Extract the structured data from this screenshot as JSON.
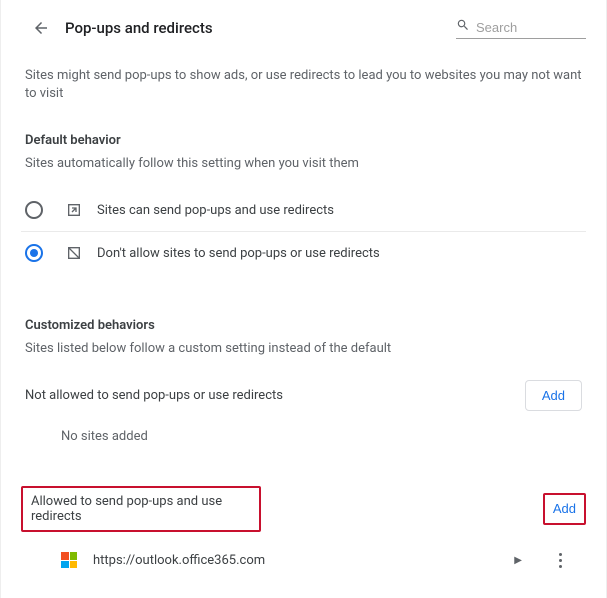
{
  "header": {
    "title": "Pop-ups and redirects"
  },
  "search": {
    "placeholder": "Search"
  },
  "intro": "Sites might send pop-ups to show ads, or use redirects to lead you to websites you may not want to visit",
  "default_behavior": {
    "heading": "Default behavior",
    "sub": "Sites automatically follow this setting when you visit them",
    "option_allow": "Sites can send pop-ups and use redirects",
    "option_block": "Don't allow sites to send pop-ups or use redirects"
  },
  "custom": {
    "heading": "Customized behaviors",
    "sub": "Sites listed below follow a custom setting instead of the default",
    "block_label": "Not allowed to send pop-ups or use redirects",
    "block_empty": "No sites added",
    "allow_label": "Allowed to send pop-ups and use redirects",
    "add_label": "Add"
  },
  "allowed_sites": {
    "0": {
      "url": "https://outlook.office365.com"
    }
  }
}
